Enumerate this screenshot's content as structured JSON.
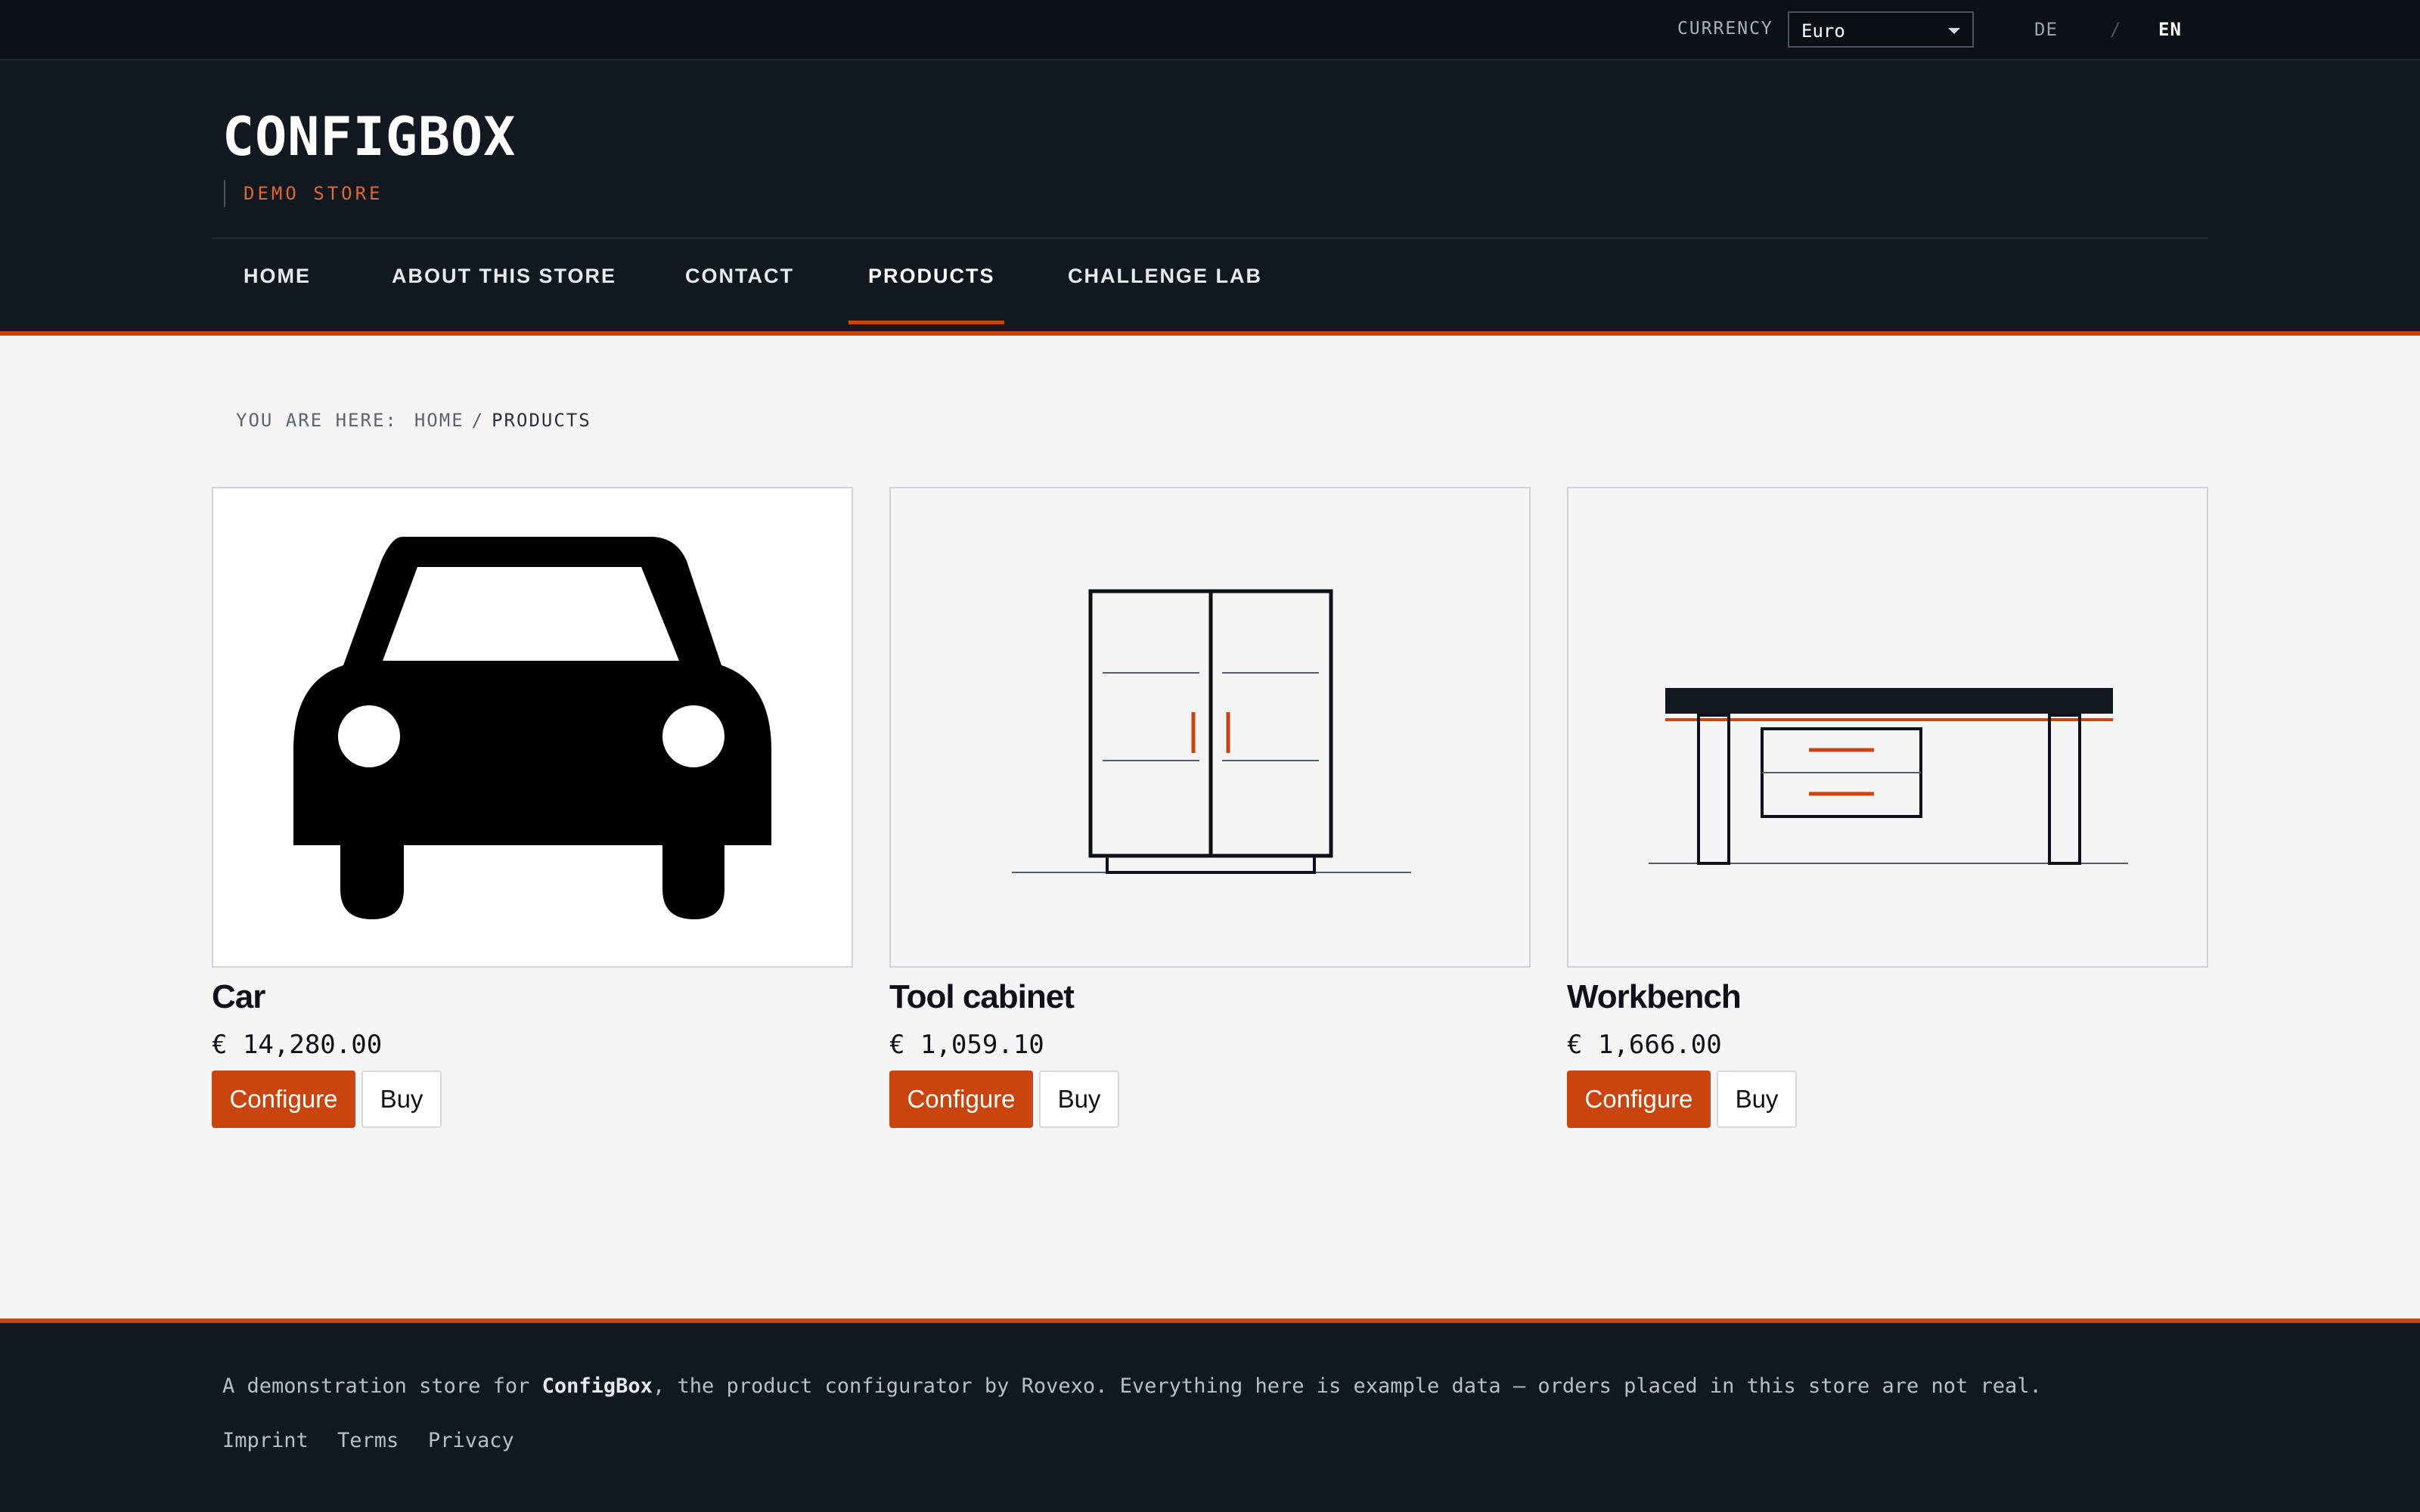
{
  "topbar": {
    "currency_label": "CURRENCY",
    "currency_value": "Euro",
    "lang_de": "DE",
    "lang_sep": "/",
    "lang_en": "EN"
  },
  "header": {
    "brand": "CONFIGBOX",
    "tagline": "DEMO STORE"
  },
  "nav": {
    "items": [
      "HOME",
      "ABOUT THIS STORE",
      "CONTACT",
      "PRODUCTS",
      "CHALLENGE LAB"
    ],
    "active": "PRODUCTS"
  },
  "breadcrumb": {
    "prefix": "YOU ARE HERE:",
    "home": "HOME",
    "sep": "/",
    "current": "PRODUCTS"
  },
  "products": [
    {
      "name": "Car",
      "price": "€ 14,280.00",
      "icon": "car-icon",
      "configure_label": "Configure",
      "buy_label": "Buy"
    },
    {
      "name": "Tool cabinet",
      "price": "€ 1,059.10",
      "icon": "cabinet-icon",
      "configure_label": "Configure",
      "buy_label": "Buy"
    },
    {
      "name": "Workbench",
      "price": "€ 1,666.00",
      "icon": "workbench-icon",
      "configure_label": "Configure",
      "buy_label": "Buy"
    }
  ],
  "footer": {
    "note_before": "A demonstration store for ",
    "note_brand": "ConfigBox",
    "note_after": ", the product configurator by Rovexo. Everything here is example data — orders placed in this store are not real.",
    "links": [
      "Imprint",
      "Terms",
      "Privacy"
    ]
  },
  "colors": {
    "accent": "#c9440f",
    "dark": "#121820",
    "page_bg": "#f4f5f4"
  }
}
